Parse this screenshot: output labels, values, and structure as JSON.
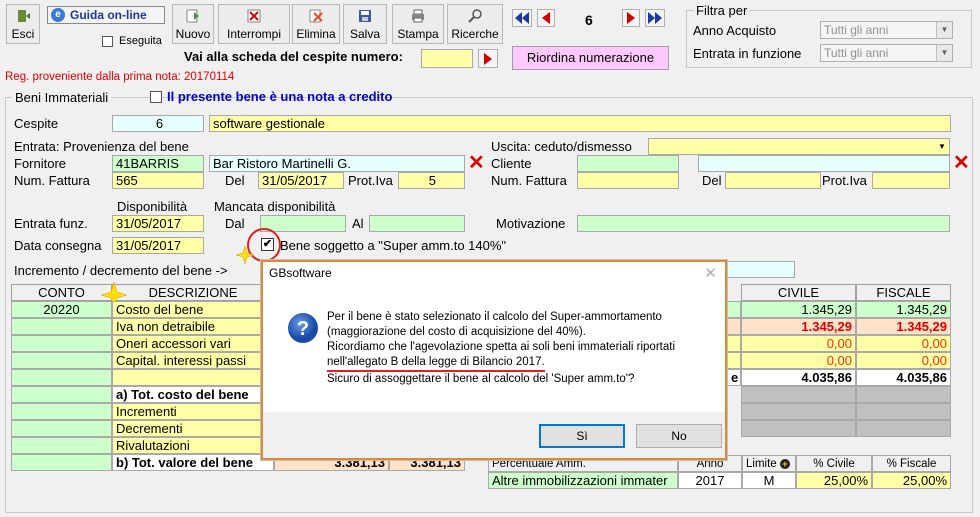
{
  "toolbar": {
    "esci": "Esci",
    "guida": "Guida on-line",
    "eseguita": "Eseguita",
    "nuovo": "Nuovo",
    "interrompi": "Interrompi",
    "elimina": "Elimina",
    "salva": "Salva",
    "stampa": "Stampa",
    "ricerche": "Ricerche",
    "record_number": "6",
    "goto_label": "Vai alla scheda del cespite numero:",
    "goto_value": "",
    "riordina": "Riordina numerazione"
  },
  "filter": {
    "title": "Filtra per",
    "anno_acquisto_label": "Anno Acquisto",
    "anno_acquisto_value": "Tutti gli anni",
    "entrata_label": "Entrata in funzione",
    "entrata_value": "Tutti gli anni"
  },
  "reg_note": "Reg. proveniente dalla prima nota: 20170114",
  "section": {
    "beni_immateriali": "Beni Immateriali",
    "nota_credito_label": "Il presente bene è una nota a credito"
  },
  "cespite": {
    "label": "Cespite",
    "number": "6",
    "description": "software gestionale"
  },
  "entrata": {
    "title": "Entrata: Provenienza del bene",
    "fornitore_label": "Fornitore",
    "fornitore_code": "41BARRIS",
    "fornitore_name": "Bar Ristoro Martinelli G.",
    "num_fattura_label": "Num. Fattura",
    "num_fattura": "565",
    "del_label": "Del",
    "del_value": "31/05/2017",
    "prot_iva_label": "Prot.Iva",
    "prot_iva": "5"
  },
  "uscita": {
    "title": "Uscita: ceduto/dismesso",
    "cliente_label": "Cliente",
    "num_fattura_label": "Num. Fattura",
    "del_label": "Del",
    "prot_iva_label": "Prot.Iva"
  },
  "disponibilita": {
    "disponibilita_label": "Disponibilità",
    "mancata_label": "Mancata disponibilità",
    "entrata_funz_label": "Entrata funz.",
    "entrata_funz_value": "31/05/2017",
    "dal_label": "Dal",
    "al_label": "Al",
    "motivazione_label": "Motivazione",
    "data_consegna_label": "Data consegna",
    "data_consegna_value": "31/05/2017",
    "super_amm_label": "Bene soggetto a \"Super amm.to 140%\""
  },
  "incremento_label": "Incremento / decremento del bene ->",
  "table": {
    "conto_header": "CONTO",
    "descrizione_header": "DESCRIZIONE",
    "civile_header": "CIVILE",
    "fiscale_header": "FISCALE",
    "conto_value": "20220",
    "rows": [
      {
        "desc": "Costo del bene",
        "civile": "1.345,29",
        "fiscale": "1.345,29"
      },
      {
        "desc": "Iva non detraibile",
        "civile": "1.345,29",
        "fiscale": "1.345,29"
      },
      {
        "desc": "Oneri accessori vari",
        "civile": "0,00",
        "fiscale": "0,00"
      },
      {
        "desc": "Capital. interessi passi",
        "civile": "0,00",
        "fiscale": "0,00"
      }
    ],
    "tot_a_label": "a) Tot. costo del bene",
    "tot_a_civile": "4.035,86",
    "tot_a_fiscale": "4.035,86",
    "row_e_fragment": "e",
    "incrementi": "Incrementi",
    "decrementi": "Decrementi",
    "rivalutazioni": "Rivalutazioni",
    "tot_b_label": "b) Tot. valore del bene",
    "tot_b_v1": "3.381,13",
    "tot_b_v2": "3.381,13"
  },
  "ammortamento": {
    "percentuale_label": "Percentuale Amm.",
    "anno_label": "Anno",
    "limite_label": "Limite",
    "civile_label": "% Civile",
    "fiscale_label": "% Fiscale",
    "categoria": "Altre immobilizzazioni immater",
    "anno": "2017",
    "limite": "M",
    "civile": "25,00%",
    "fiscale": "25,00%"
  },
  "dialog": {
    "title": "GBsoftware",
    "line1": "Per il bene è stato selezionato il calcolo del Super-ammortamento",
    "line2": "(maggiorazione del costo di acquisizione del 40%).",
    "line3": "Ricordiamo che l'agevolazione spetta ai soli beni immateriali riportati",
    "line4": "nell'allegato B della legge di Bilancio 2017.",
    "line5": "Sicuro di assoggettare il bene al calcolo del 'Super amm.to'?",
    "yes": "Sì",
    "no": "No"
  },
  "colors": {
    "yellow_field": "#ffffa8",
    "green_field": "#ccffcc",
    "cyan_field": "#e6ffff",
    "red_accent": "#e00000",
    "dialog_border": "#e08a30",
    "link_blue": "#0000cc"
  }
}
